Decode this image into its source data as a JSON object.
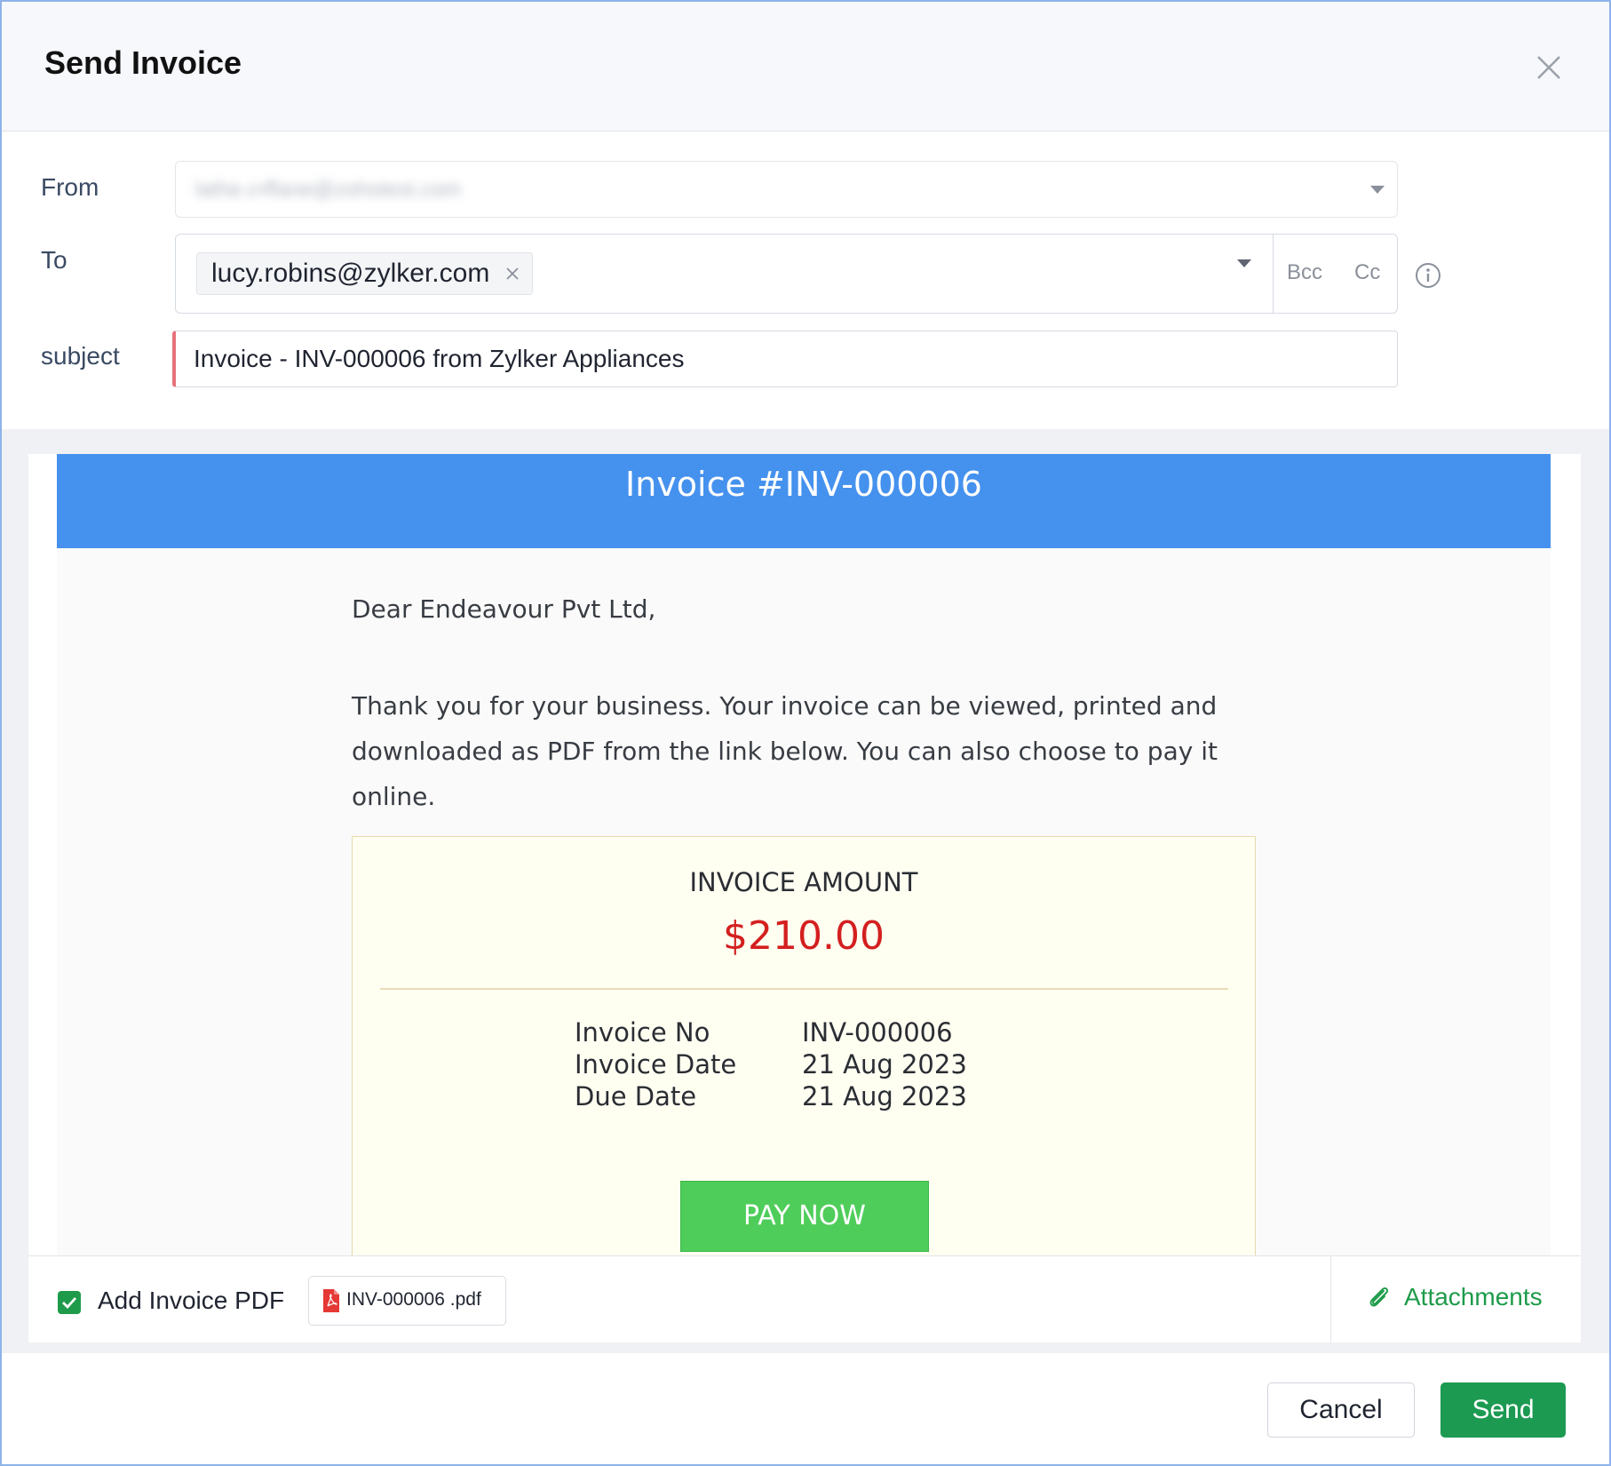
{
  "dialog": {
    "title": "Send Invoice"
  },
  "form": {
    "from_label": "From",
    "from_value": "lathe.c•ffane@zohotest.com",
    "to_label": "To",
    "to_recipient": "lucy.robins@zylker.com",
    "bcc_label": "Bcc",
    "cc_label": "Cc",
    "subject_label": "subject",
    "subject_value": "Invoice - INV-000006 from Zylker Appliances"
  },
  "email": {
    "banner_title": "Invoice #INV-000006",
    "greeting": "Dear Endeavour Pvt Ltd,",
    "message_line1": "Thank you for your business. Your invoice can be viewed, printed and",
    "message_line2": "downloaded as PDF from the link below. You can also choose to pay it online.",
    "amount_label": "INVOICE AMOUNT",
    "amount_value": "$210.00",
    "details": {
      "invoice_no_label": "Invoice No",
      "invoice_no_value": "INV-000006",
      "invoice_date_label": "Invoice Date",
      "invoice_date_value": "21 Aug 2023",
      "due_date_label": "Due Date",
      "due_date_value": "21 Aug 2023"
    },
    "pay_now_label": "PAY NOW"
  },
  "attachments": {
    "add_pdf_label": "Add Invoice PDF",
    "add_pdf_checked": true,
    "pdf_file_name": "INV-000006 .pdf",
    "attachments_label": "Attachments"
  },
  "footer": {
    "cancel_label": "Cancel",
    "send_label": "Send"
  },
  "colors": {
    "banner": "#4591ee",
    "amount": "#d41f1f",
    "pay_now": "#4fcd5a",
    "send": "#1c9a52",
    "subject_required_marker": "#e6727a",
    "attachments_link": "#1e9b4a"
  },
  "icons": {
    "close": "close-icon",
    "chip_remove": "close-icon",
    "dropdown": "chevron-down-icon",
    "info": "info-icon",
    "checkbox": "check-icon",
    "pdf": "pdf-file-icon",
    "attachments": "paperclip-icon"
  }
}
